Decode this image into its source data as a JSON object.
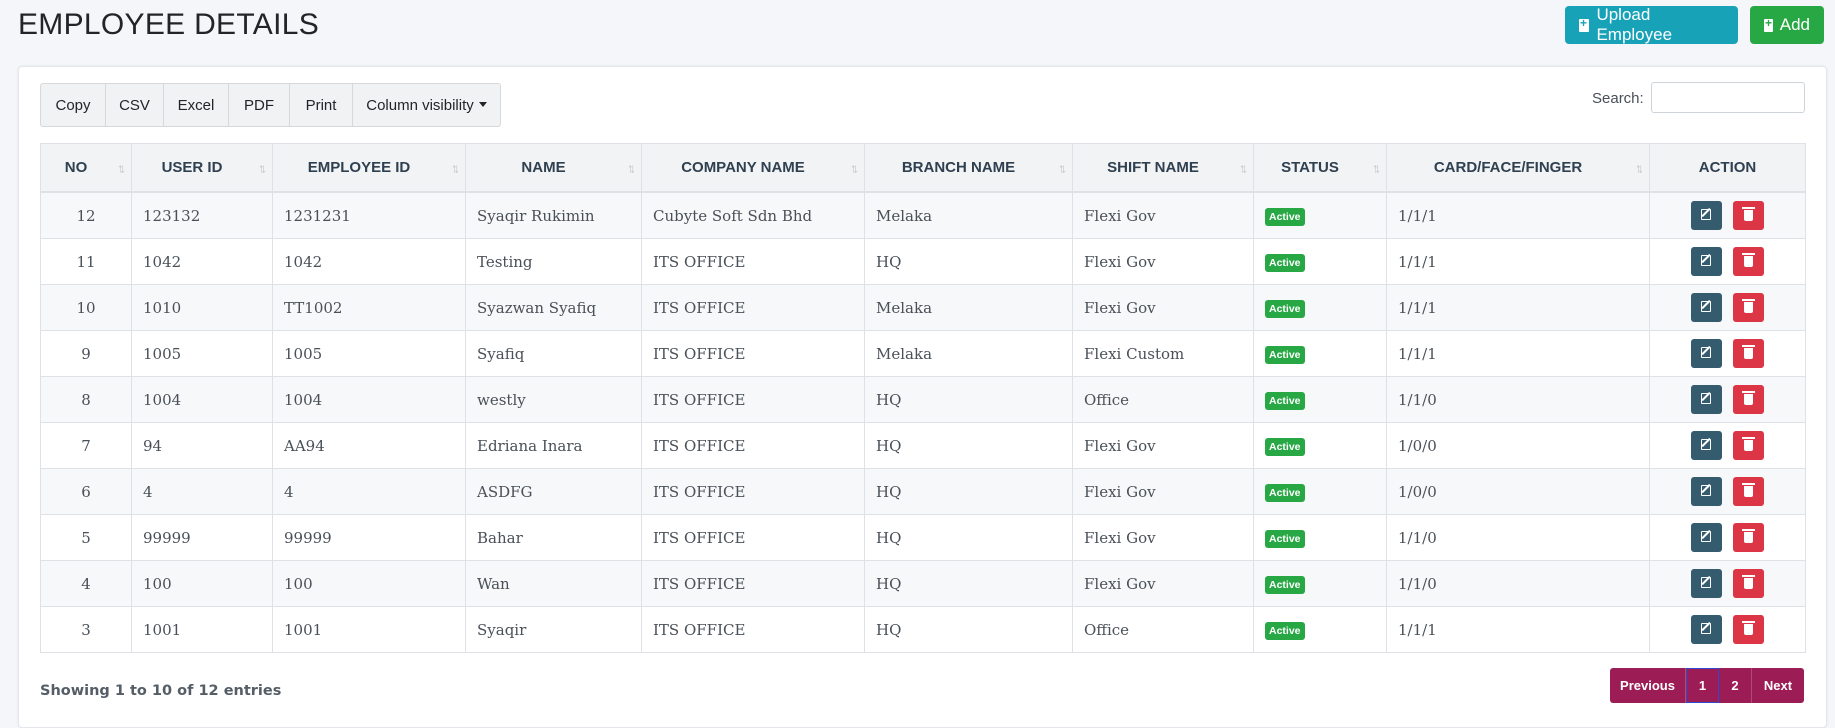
{
  "header": {
    "title": "EMPLOYEE DETAILS",
    "upload_label": "Upload Employee",
    "add_label": "Add"
  },
  "toolbar": {
    "copy": "Copy",
    "csv": "CSV",
    "excel": "Excel",
    "pdf": "PDF",
    "print": "Print",
    "column_visibility": "Column visibility"
  },
  "search": {
    "label": "Search:",
    "value": "",
    "placeholder": ""
  },
  "table": {
    "columns": [
      "NO",
      "USER ID",
      "EMPLOYEE ID",
      "NAME",
      "COMPANY NAME",
      "BRANCH NAME",
      "SHIFT NAME",
      "STATUS",
      "CARD/FACE/FINGER",
      "ACTION"
    ],
    "rows": [
      {
        "no": "12",
        "user_id": "123132",
        "employee_id": "1231231",
        "name": "Syaqir Rukimin",
        "company": "Cubyte Soft Sdn Bhd",
        "branch": "Melaka",
        "shift": "Flexi Gov",
        "status": "Active",
        "cff": "1/1/1"
      },
      {
        "no": "11",
        "user_id": "1042",
        "employee_id": "1042",
        "name": "Testing",
        "company": "ITS OFFICE",
        "branch": "HQ",
        "shift": "Flexi Gov",
        "status": "Active",
        "cff": "1/1/1"
      },
      {
        "no": "10",
        "user_id": "1010",
        "employee_id": "TT1002",
        "name": "Syazwan Syafiq",
        "company": "ITS OFFICE",
        "branch": "Melaka",
        "shift": "Flexi Gov",
        "status": "Active",
        "cff": "1/1/1"
      },
      {
        "no": "9",
        "user_id": "1005",
        "employee_id": "1005",
        "name": "Syafiq",
        "company": "ITS OFFICE",
        "branch": "Melaka",
        "shift": "Flexi Custom",
        "status": "Active",
        "cff": "1/1/1"
      },
      {
        "no": "8",
        "user_id": "1004",
        "employee_id": "1004",
        "name": "westly",
        "company": "ITS OFFICE",
        "branch": "HQ",
        "shift": "Office",
        "status": "Active",
        "cff": "1/1/0"
      },
      {
        "no": "7",
        "user_id": "94",
        "employee_id": "AA94",
        "name": "Edriana Inara",
        "company": "ITS OFFICE",
        "branch": "HQ",
        "shift": "Flexi Gov",
        "status": "Active",
        "cff": "1/0/0"
      },
      {
        "no": "6",
        "user_id": "4",
        "employee_id": "4",
        "name": "ASDFG",
        "company": "ITS OFFICE",
        "branch": "HQ",
        "shift": "Flexi Gov",
        "status": "Active",
        "cff": "1/0/0"
      },
      {
        "no": "5",
        "user_id": "99999",
        "employee_id": "99999",
        "name": "Bahar",
        "company": "ITS OFFICE",
        "branch": "HQ",
        "shift": "Flexi Gov",
        "status": "Active",
        "cff": "1/1/0"
      },
      {
        "no": "4",
        "user_id": "100",
        "employee_id": "100",
        "name": "Wan",
        "company": "ITS OFFICE",
        "branch": "HQ",
        "shift": "Flexi Gov",
        "status": "Active",
        "cff": "1/1/0"
      },
      {
        "no": "3",
        "user_id": "1001",
        "employee_id": "1001",
        "name": "Syaqir",
        "company": "ITS OFFICE",
        "branch": "HQ",
        "shift": "Office",
        "status": "Active",
        "cff": "1/1/1"
      }
    ]
  },
  "footer": {
    "info": "Showing 1 to 10 of 12 entries",
    "previous": "Previous",
    "pages": [
      "1",
      "2"
    ],
    "active_page": "1",
    "next": "Next"
  },
  "colors": {
    "upload": "#17a2b8",
    "add": "#28a745",
    "status_active": "#28a745",
    "edit": "#355c6e",
    "delete": "#dc3545",
    "pagination": "#9c1d55"
  },
  "icons": {
    "upload": "file-plus-icon",
    "add": "file-plus-icon",
    "edit": "edit-icon",
    "delete": "trash-icon",
    "sort": "sort-icon"
  }
}
